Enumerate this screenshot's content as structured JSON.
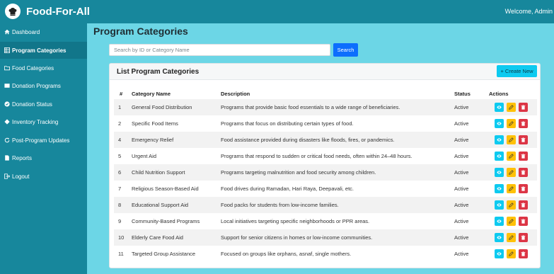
{
  "app": {
    "name": "Food-For-All",
    "welcome": "Welcome, Admin"
  },
  "sidebar": {
    "items": [
      {
        "label": "Dashboard",
        "icon": "home-icon",
        "active": false
      },
      {
        "label": "Program Categories",
        "icon": "grid-icon",
        "active": true
      },
      {
        "label": "Food Categories",
        "icon": "folder-icon",
        "active": false
      },
      {
        "label": "Donation Programs",
        "icon": "box-icon",
        "active": false
      },
      {
        "label": "Donation Status",
        "icon": "status-icon",
        "active": false
      },
      {
        "label": "Inventory Tracking",
        "icon": "diamond-icon",
        "active": false
      },
      {
        "label": "Post-Program Updates",
        "icon": "refresh-icon",
        "active": false
      },
      {
        "label": "Reports",
        "icon": "report-icon",
        "active": false
      },
      {
        "label": "Logout",
        "icon": "logout-icon",
        "active": false
      }
    ]
  },
  "page": {
    "title": "Program Categories"
  },
  "search": {
    "placeholder": "Search by ID or Category Name",
    "value": "",
    "button": "Search"
  },
  "card": {
    "title": "List Program Categories",
    "create_label": "+ Create New"
  },
  "table": {
    "headers": {
      "num": "#",
      "name": "Category Name",
      "desc": "Description",
      "status": "Status",
      "actions": "Actions"
    },
    "rows": [
      {
        "num": "1",
        "name": "General Food Distribution",
        "desc": "Programs that provide basic food essentials to a wide range of beneficiaries.",
        "status": "Active"
      },
      {
        "num": "2",
        "name": "Specific Food Items",
        "desc": "Programs that focus on distributing certain types of food.",
        "status": "Active"
      },
      {
        "num": "4",
        "name": "Emergency Relief",
        "desc": "Food assistance provided during disasters like floods, fires, or pandemics.",
        "status": "Active"
      },
      {
        "num": "5",
        "name": "Urgent Aid",
        "desc": "Programs that respond to sudden or critical food needs, often within 24–48 hours.",
        "status": "Active"
      },
      {
        "num": "6",
        "name": "Child Nutrition Support",
        "desc": "Programs targeting malnutrition and food security among children.",
        "status": "Active"
      },
      {
        "num": "7",
        "name": "Religious Season-Based Aid",
        "desc": "Food drives during Ramadan, Hari Raya, Deepavali, etc.",
        "status": "Active"
      },
      {
        "num": "8",
        "name": "Educational Support Aid",
        "desc": "Food packs for students from low-income families.",
        "status": "Active"
      },
      {
        "num": "9",
        "name": "Community-Based Programs",
        "desc": "Local initiatives targeting specific neighborhoods or PPR areas.",
        "status": "Active"
      },
      {
        "num": "10",
        "name": "Elderly Care Food Aid",
        "desc": "Support for senior citizens in homes or low-income communities.",
        "status": "Active"
      },
      {
        "num": "11",
        "name": "Targeted Group Assistance",
        "desc": "Focused on groups like orphans, asnaf, single mothers.",
        "status": "Active"
      }
    ]
  },
  "colors": {
    "sidebar": "#17879c",
    "background": "#6cd6e6",
    "primary": "#0d6efd",
    "info": "#0dcaf0",
    "warning": "#ffc107",
    "danger": "#dc3545"
  }
}
